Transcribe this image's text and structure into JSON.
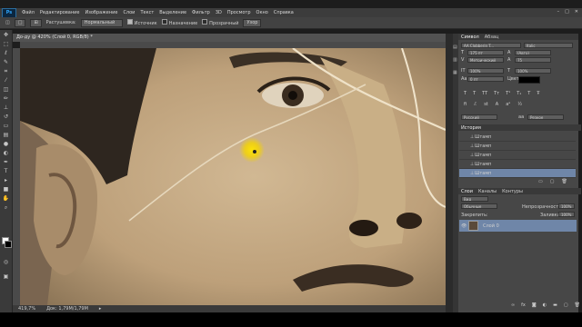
{
  "app": {
    "logo": "Ps",
    "window_controls": [
      "–",
      "□",
      "✕"
    ]
  },
  "menu": [
    "Файл",
    "Редактирование",
    "Изображение",
    "Слои",
    "Текст",
    "Выделение",
    "Фильтр",
    "3D",
    "Просмотр",
    "Окно",
    "Справка"
  ],
  "options": {
    "feather_label": "Растушевка:",
    "mode_value": "Нормальный",
    "source_label": "Источник",
    "pattern_label": "Назначение",
    "transparent_label": "Прозрачный",
    "use_pattern": "Узор"
  },
  "document": {
    "title": "До-ду @ 420% (Слой 0, RGB/8) *",
    "zoom": "419,7%",
    "doc_size": "Док: 1,79М/1,79М"
  },
  "character": {
    "tabs": [
      "Символ",
      "Абзац"
    ],
    "font_family": "AA Clobberin T...",
    "font_style": "Italic",
    "size": "175 пт",
    "leading": "(Авто)",
    "kerning": "Метрический",
    "tracking": "75",
    "scale_v": "100%",
    "scale_h": "100%",
    "baseline": "0 пт",
    "color_label": "Цвет:",
    "language": "Русский",
    "antialias": "Резкое",
    "aa": "аа"
  },
  "history": {
    "title": "История",
    "items": [
      "Штамп",
      "Штамп",
      "Штамп",
      "Штамп",
      "Штамп"
    ]
  },
  "layers": {
    "tabs": [
      "Слои",
      "Каналы",
      "Контуры"
    ],
    "kind": "Вид",
    "blend_mode": "Обычные",
    "opacity_label": "Непрозрачность:",
    "opacity": "100%",
    "lock_label": "Закрепить:",
    "fill_label": "Заливка:",
    "fill": "100%",
    "layer_name": "Слой 0"
  },
  "colors": {
    "accent": "#6f86a8",
    "cursor_highlight": "#f5d400",
    "photo_base": "#c2a981"
  }
}
